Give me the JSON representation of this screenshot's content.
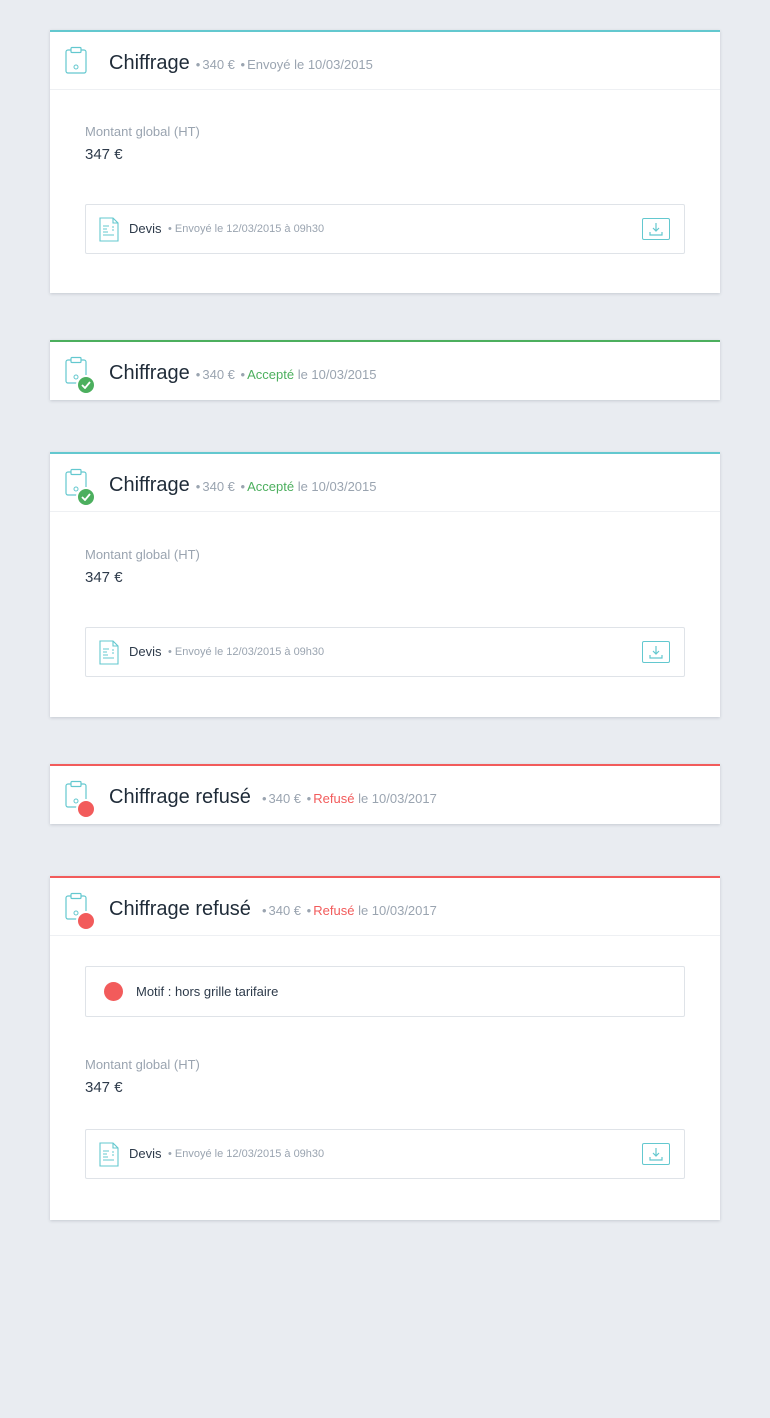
{
  "colors": {
    "accent": "#63c8cf",
    "success": "#4caf5e",
    "danger": "#f25b5b"
  },
  "cards": [
    {
      "title": "Chiffrage",
      "amount": "340 €",
      "status": "Envoyé",
      "status_suffix": "le 10/03/2015",
      "icon": "clipboard-icon",
      "detail": {
        "amount_label": "Montant global (HT)",
        "amount_value": "347 €",
        "document": {
          "name": "Devis",
          "meta": "Envoyé le 12/03/2015 à 09h30",
          "icon": "document-icon",
          "action_icon": "download-icon"
        }
      }
    },
    {
      "title": "Chiffrage",
      "amount": "340 €",
      "status": "Accepté",
      "status_suffix": "le 10/03/2015",
      "icon": "clipboard-check-icon"
    },
    {
      "title": "Chiffrage",
      "amount": "340 €",
      "status": "Accepté",
      "status_suffix": "le 10/03/2015",
      "icon": "clipboard-check-icon",
      "detail": {
        "amount_label": "Montant global (HT)",
        "amount_value": "347 €",
        "document": {
          "name": "Devis",
          "meta": "Envoyé le 12/03/2015 à 09h30",
          "icon": "document-icon",
          "action_icon": "download-icon"
        }
      }
    },
    {
      "title": "Chiffrage refusé",
      "amount": "340 €",
      "status": "Refusé",
      "status_suffix": "le 10/03/2017",
      "icon": "clipboard-refused-icon"
    },
    {
      "title": "Chiffrage refusé",
      "amount": "340 €",
      "status": "Refusé",
      "status_suffix": "le 10/03/2017",
      "icon": "clipboard-refused-icon",
      "reason": "Motif : hors grille tarifaire",
      "detail": {
        "amount_label": "Montant global (HT)",
        "amount_value": "347 €",
        "document": {
          "name": "Devis",
          "meta": "Envoyé le 12/03/2015 à 09h30",
          "icon": "document-icon",
          "action_icon": "download-icon"
        }
      }
    }
  ]
}
